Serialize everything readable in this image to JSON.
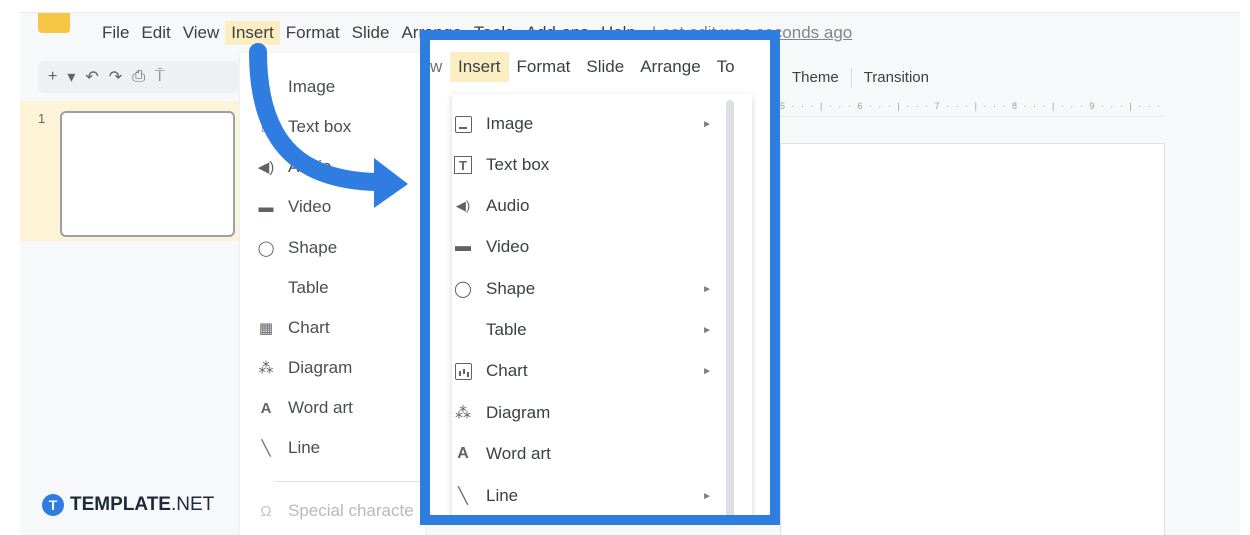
{
  "menubar": {
    "items": [
      "File",
      "Edit",
      "View",
      "Insert",
      "Format",
      "Slide",
      "Arrange",
      "Tools",
      "Add-ons",
      "Help"
    ],
    "active": "Insert",
    "last_edit": "Last edit was seconds ago"
  },
  "toolbar": {
    "icons": [
      "+",
      "▾",
      "↶",
      "↷",
      "⎙",
      "⍑"
    ]
  },
  "filmstrip": {
    "slide_number": "1"
  },
  "background_menu": {
    "items": [
      {
        "label": "Image",
        "icon": "image-icon",
        "glyph": ""
      },
      {
        "label": "Text box",
        "icon": "text-box-icon",
        "glyph": "⌸"
      },
      {
        "label": "Audio",
        "icon": "audio-icon",
        "glyph": "◀)"
      },
      {
        "label": "Video",
        "icon": "video-icon",
        "glyph": "▬"
      },
      {
        "label": "Shape",
        "icon": "shape-icon",
        "glyph": "◯"
      },
      {
        "label": "Table",
        "icon": "",
        "glyph": ""
      },
      {
        "label": "Chart",
        "icon": "chart-icon",
        "glyph": "▦"
      },
      {
        "label": "Diagram",
        "icon": "diagram-icon",
        "glyph": "⁂"
      },
      {
        "label": "Word art",
        "icon": "word-art-icon",
        "glyph": "A"
      },
      {
        "label": "Line",
        "icon": "line-icon",
        "glyph": "╲"
      }
    ],
    "special_characters": "Special characte",
    "special_glyph": "Ω"
  },
  "editor": {
    "tabs": [
      "Theme",
      "Transition"
    ],
    "ruler": "5 · · · | · · · 6 · · · | · · · 7 · · · | · · · 8 · · · | · · · 9 · · · | · · · "
  },
  "zoom": {
    "menubar": [
      "w",
      "Insert",
      "Format",
      "Slide",
      "Arrange",
      "To"
    ],
    "active": "Insert",
    "items": [
      {
        "label": "Image",
        "icon": "image-icon",
        "submenu": true
      },
      {
        "label": "Text box",
        "icon": "text-box-icon",
        "submenu": false
      },
      {
        "label": "Audio",
        "icon": "audio-icon",
        "submenu": false
      },
      {
        "label": "Video",
        "icon": "video-icon",
        "submenu": false
      },
      {
        "label": "Shape",
        "icon": "shape-icon",
        "submenu": true
      },
      {
        "label": "Table",
        "icon": "",
        "submenu": true
      },
      {
        "label": "Chart",
        "icon": "chart-icon",
        "submenu": true
      },
      {
        "label": "Diagram",
        "icon": "diagram-icon",
        "submenu": false
      },
      {
        "label": "Word art",
        "icon": "word-art-icon",
        "submenu": false
      },
      {
        "label": "Line",
        "icon": "line-icon",
        "submenu": true
      }
    ],
    "submenu_arrow": "►",
    "text_box_glyph": "T",
    "audio_glyph": "◀)",
    "video_glyph": "▬",
    "shape_glyph": "◯",
    "diagram_glyph": "⁂",
    "word_art_glyph": "A",
    "line_glyph": "╲"
  },
  "brand": {
    "badge": "T",
    "name": "TEMPLATE",
    "suffix": ".NET"
  },
  "colors": {
    "highlight_blue": "#2f7de1",
    "active_menu": "#fbeec2",
    "filmstrip_active": "#fdf3d7"
  }
}
